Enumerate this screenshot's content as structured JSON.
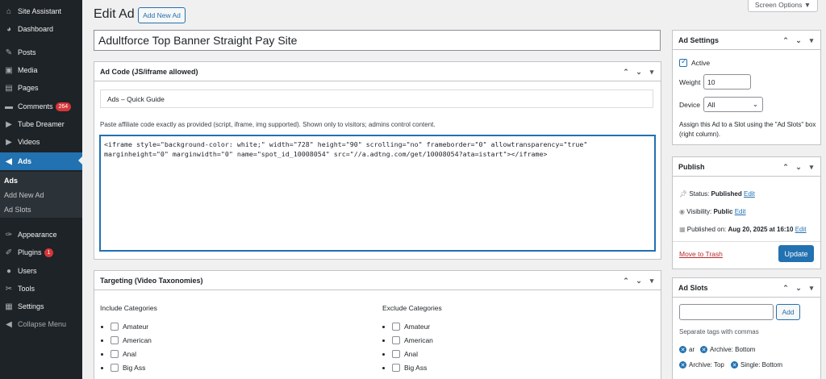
{
  "sidebar": {
    "items": [
      {
        "label": "Site Assistant",
        "icon": "home-icon",
        "glyph": "⌂"
      },
      {
        "label": "Dashboard",
        "icon": "dashboard-icon",
        "glyph": "◕"
      },
      {
        "label": "Posts",
        "icon": "pin-icon",
        "glyph": "✎"
      },
      {
        "label": "Media",
        "icon": "media-icon",
        "glyph": "▣"
      },
      {
        "label": "Pages",
        "icon": "pages-icon",
        "glyph": "▤"
      },
      {
        "label": "Comments",
        "icon": "comments-icon",
        "glyph": "▬",
        "badge": "264"
      },
      {
        "label": "Tube Dreamer",
        "icon": "video-icon",
        "glyph": "▶"
      },
      {
        "label": "Videos",
        "icon": "video-icon",
        "glyph": "▶"
      },
      {
        "label": "Ads",
        "icon": "megaphone-icon",
        "glyph": "◀"
      },
      {
        "label": "Appearance",
        "icon": "brush-icon",
        "glyph": "✑"
      },
      {
        "label": "Plugins",
        "icon": "plugin-icon",
        "glyph": "✐",
        "badge": "1"
      },
      {
        "label": "Users",
        "icon": "user-icon",
        "glyph": "●"
      },
      {
        "label": "Tools",
        "icon": "wrench-icon",
        "glyph": "✂"
      },
      {
        "label": "Settings",
        "icon": "settings-icon",
        "glyph": "▦"
      },
      {
        "label": "Collapse Menu",
        "icon": "collapse-icon",
        "glyph": "◀"
      }
    ],
    "submenu": [
      "Ads",
      "Add New Ad",
      "Ad Slots"
    ]
  },
  "header": {
    "title": "Edit Ad",
    "add_new": "Add New Ad",
    "screen_options": "Screen Options ▼"
  },
  "post_title": "Adultforce Top Banner Straight Pay Site",
  "ad_code": {
    "heading": "Ad Code (JS/iframe allowed)",
    "guide": "Ads – Quick Guide",
    "help": "Paste affiliate code exactly as provided (script, iframe, img supported). Shown only to visitors; admins control content.",
    "code": "<iframe style=\"background-color: white;\" width=\"728\" height=\"90\" scrolling=\"no\" frameborder=\"0\" allowtransparency=\"true\"\nmarginheight=\"0\" marginwidth=\"0\" name=\"spot_id_10008054\" src=\"//a.adtng.com/get/10008054?ata=istart\"></iframe>"
  },
  "targeting": {
    "heading": "Targeting (Video Taxonomies)",
    "include_title": "Include Categories",
    "exclude_title": "Exclude Categories",
    "categories": [
      "Amateur",
      "American",
      "Anal",
      "Big Ass"
    ]
  },
  "ad_settings": {
    "heading": "Ad Settings",
    "active_label": "Active",
    "weight_label": "Weight",
    "weight_value": "10",
    "device_label": "Device",
    "device_value": "All",
    "note": "Assign this Ad to a Slot using the \"Ad Slots\" box (right column)."
  },
  "publish": {
    "heading": "Publish",
    "status_label": "Status:",
    "status_value": "Published",
    "visibility_label": "Visibility:",
    "visibility_value": "Public",
    "published_label": "Published on:",
    "published_value": "Aug 20, 2025 at 16:10",
    "edit": "Edit",
    "trash": "Move to Trash",
    "update": "Update"
  },
  "ad_slots": {
    "heading": "Ad Slots",
    "add_button": "Add",
    "help": "Separate tags with commas",
    "tags": [
      "ar",
      "Archive: Bottom",
      "Archive: Top",
      "Single: Bottom"
    ]
  },
  "colors": {
    "accent": "#2271b1",
    "sidebar": "#1d2327",
    "badge": "#d63638"
  }
}
